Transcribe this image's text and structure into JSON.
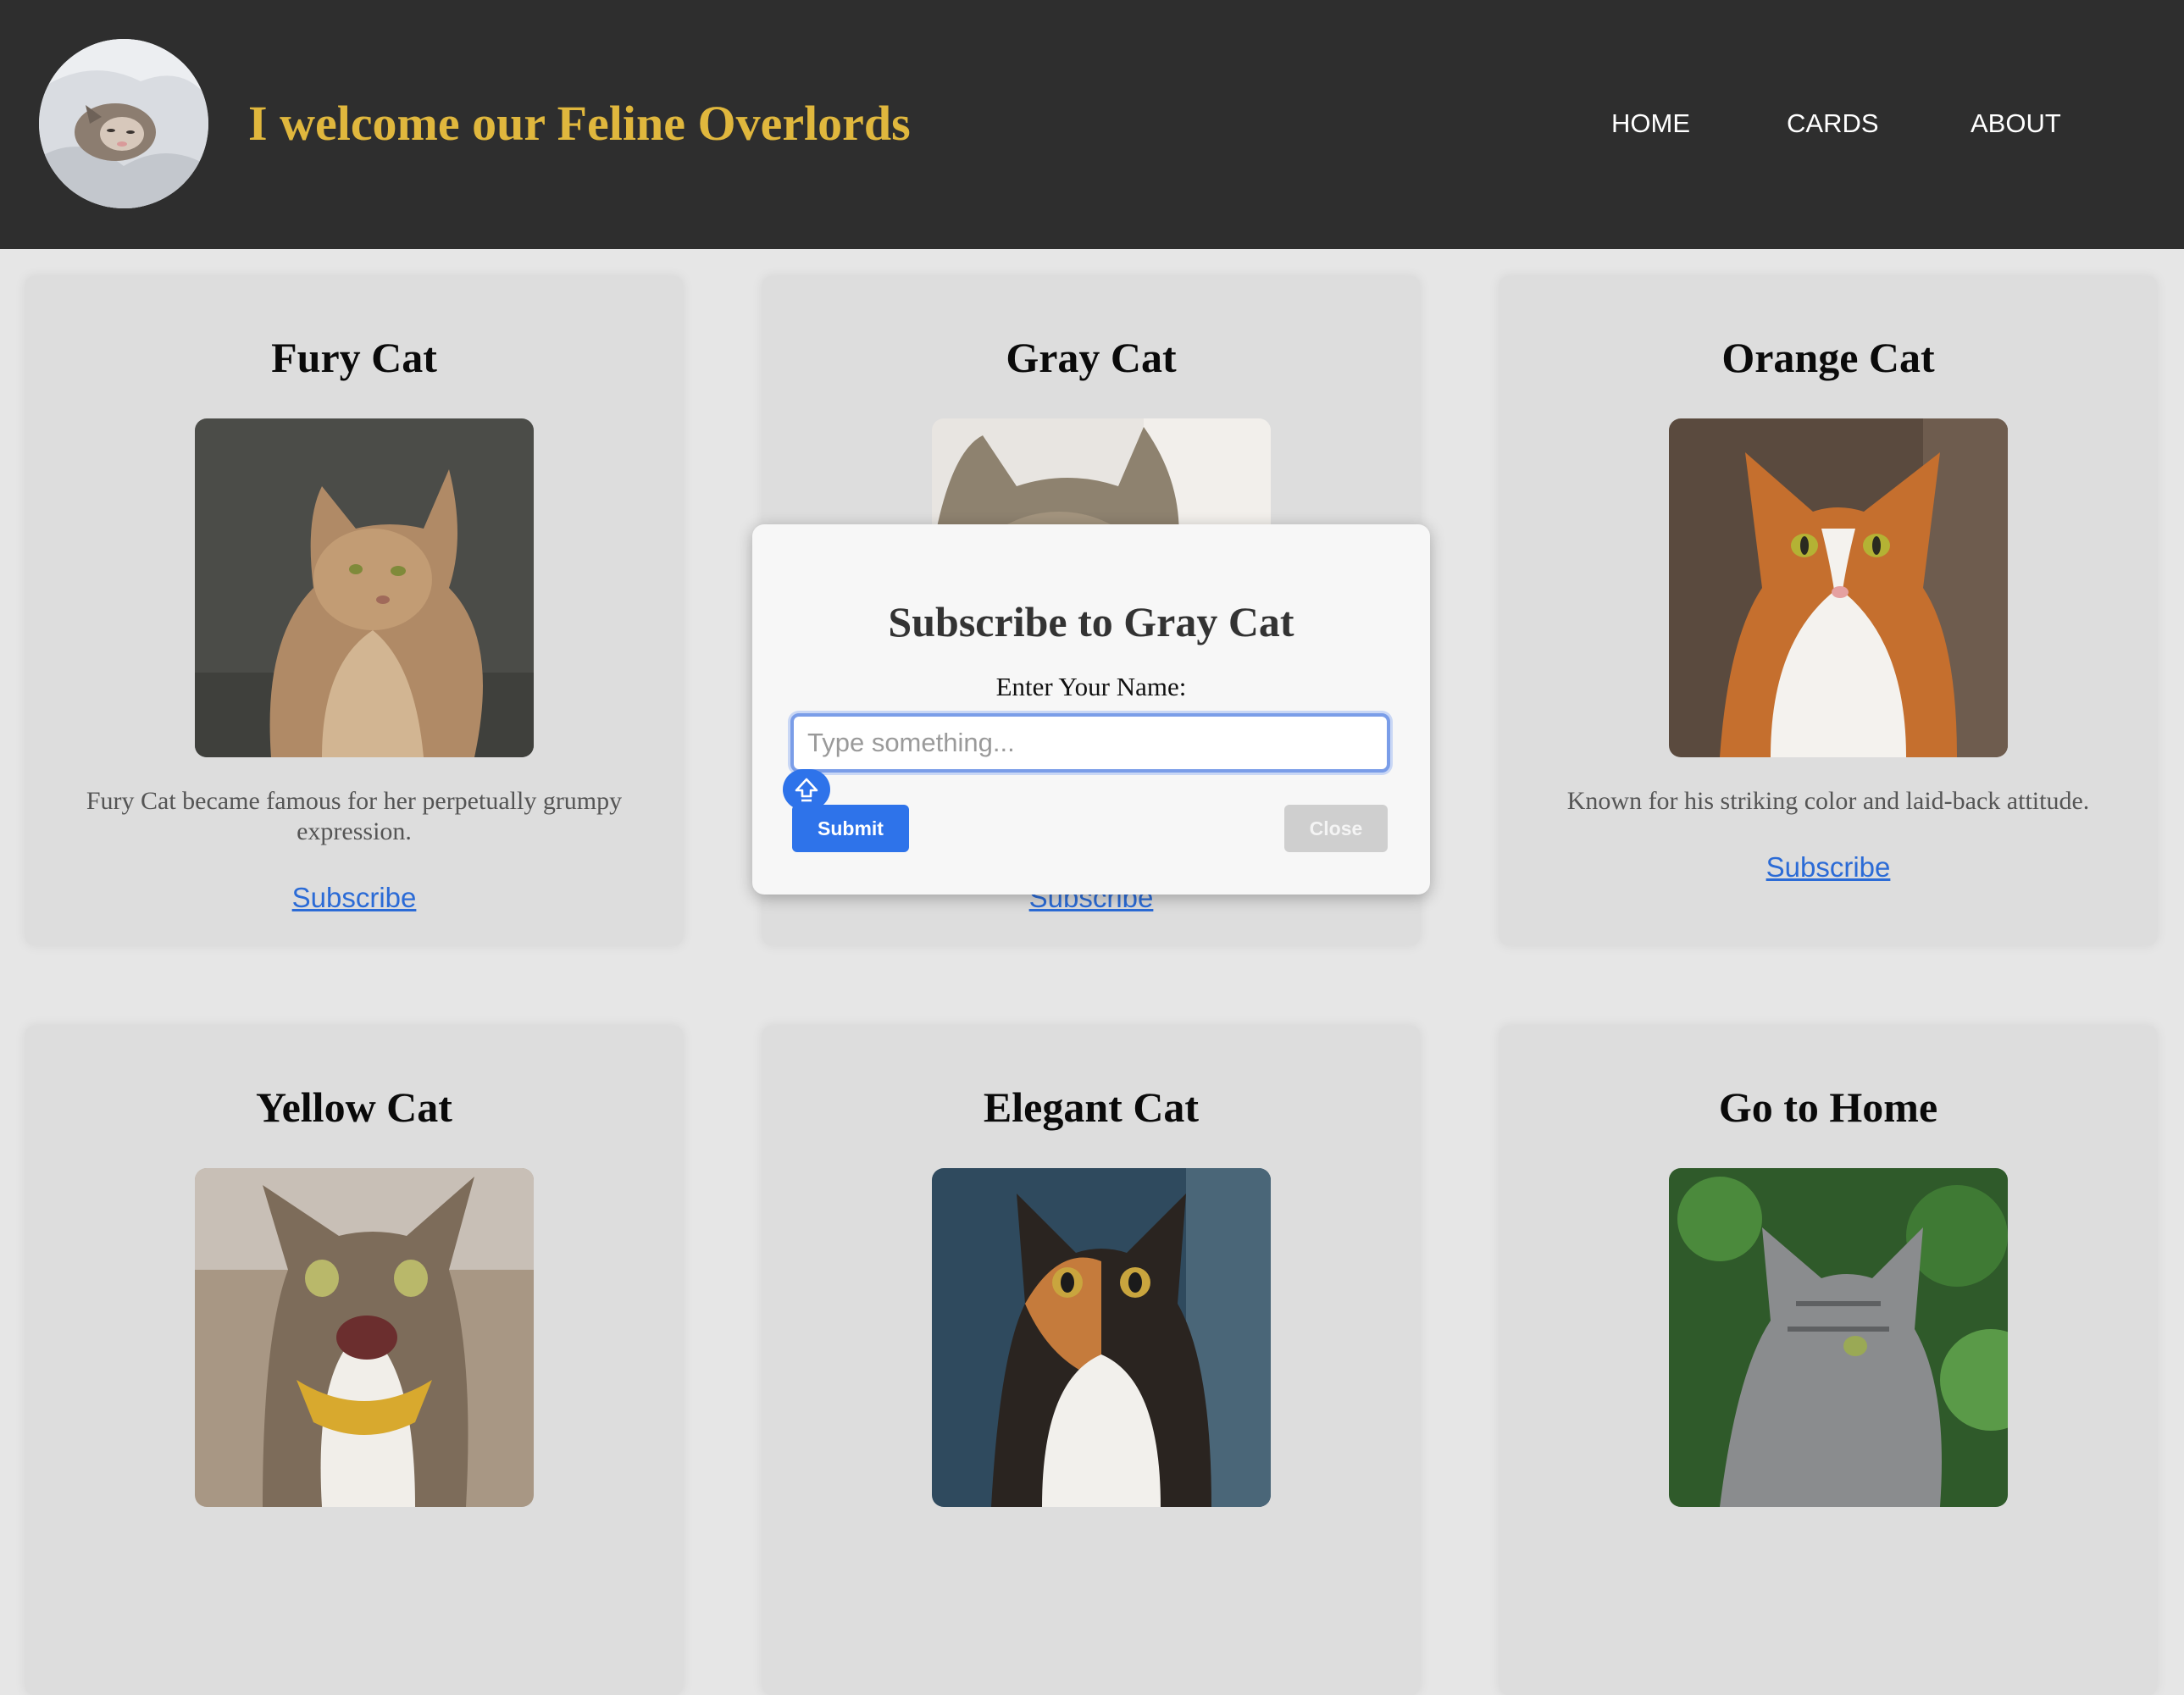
{
  "header": {
    "title": "I welcome our Feline Overlords",
    "nav": [
      "HOME",
      "CARDS",
      "ABOUT"
    ]
  },
  "cards": [
    {
      "title": "Fury Cat",
      "description": "Fury Cat became famous for her perpetually grumpy expression.",
      "link": "Subscribe"
    },
    {
      "title": "Gray Cat",
      "description": "",
      "link": "Subscribe"
    },
    {
      "title": "Orange Cat",
      "description": "Known for his striking color and laid-back attitude.",
      "link": "Subscribe"
    },
    {
      "title": "Yellow Cat",
      "description": "",
      "link": ""
    },
    {
      "title": "Elegant Cat",
      "description": "",
      "link": ""
    },
    {
      "title": "Go to Home",
      "description": "",
      "link": ""
    }
  ],
  "modal": {
    "title": "Subscribe to Gray Cat",
    "label": "Enter Your Name:",
    "placeholder": "Type something...",
    "submit_label": "Submit",
    "close_label": "Close"
  },
  "colors": {
    "header_bg": "#2e2e2e",
    "title_gold": "#e0b73d",
    "link_blue": "#2b6bd6",
    "button_blue": "#2e73ea"
  }
}
